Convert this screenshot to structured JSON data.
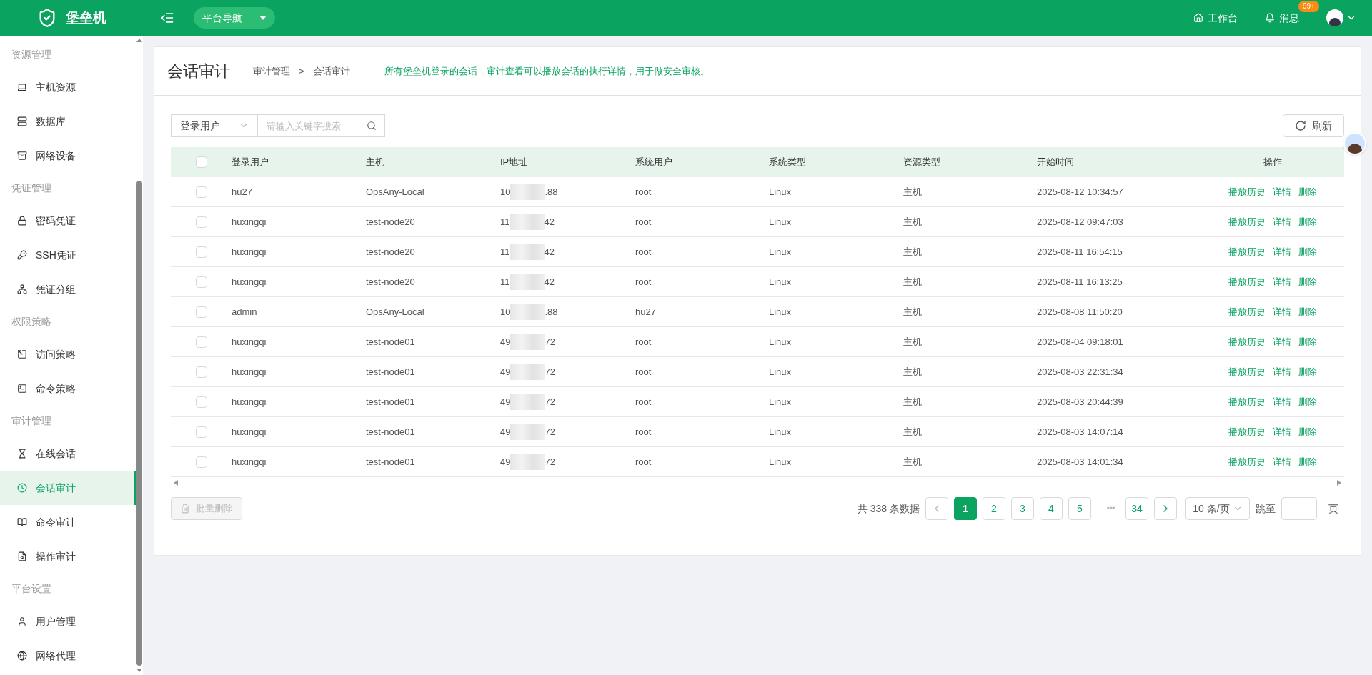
{
  "header": {
    "logo": "堡垒机",
    "nav_button": "平台导航",
    "links": [
      {
        "kind": "home",
        "label": "工作台"
      },
      {
        "kind": "bell",
        "label": "消息",
        "badge": "99+"
      }
    ]
  },
  "sidebar": {
    "groups": [
      {
        "title": "资源管理",
        "items": [
          {
            "label": "主机资源",
            "selected": false
          },
          {
            "label": "数据库",
            "selected": false
          },
          {
            "label": "网络设备",
            "selected": false
          }
        ]
      },
      {
        "title": "凭证管理",
        "items": [
          {
            "label": "密码凭证",
            "selected": false
          },
          {
            "label": "SSH凭证",
            "selected": false
          },
          {
            "label": "凭证分组",
            "selected": false
          }
        ]
      },
      {
        "title": "权限策略",
        "items": [
          {
            "label": "访问策略",
            "selected": false
          },
          {
            "label": "命令策略",
            "selected": false
          }
        ]
      },
      {
        "title": "审计管理",
        "items": [
          {
            "label": "在线会话",
            "selected": false
          },
          {
            "label": "会话审计",
            "selected": true
          },
          {
            "label": "命令审计",
            "selected": false
          },
          {
            "label": "操作审计",
            "selected": false
          }
        ]
      },
      {
        "title": "平台设置",
        "items": [
          {
            "label": "用户管理",
            "selected": false
          },
          {
            "label": "网络代理",
            "selected": false
          }
        ]
      }
    ]
  },
  "page": {
    "title": "会话审计",
    "breadcrumb": [
      "审计管理",
      "会话审计"
    ],
    "breadcrumb_separator": ">",
    "description": "所有堡垒机登录的会话，审计查看可以播放会话的执行详情，用于做安全审核。"
  },
  "toolbar": {
    "filter": "登录用户",
    "search_placeholder": "请输入关键字搜索",
    "refresh": "刷新"
  },
  "table": {
    "columns": [
      "登录用户",
      "主机",
      "IP地址",
      "系统用户",
      "系统类型",
      "资源类型",
      "开始时间",
      "操作"
    ],
    "select_all": false,
    "rows": [
      {
        "checked": false,
        "user": "hu27",
        "host": "OpsAny-Local",
        "ip_start": "10",
        "ip_end": ".88",
        "sys_user": "root",
        "os": "Linux",
        "res": "主机",
        "time": "2025-08-12 10:34:57",
        "actions": [
          "播放历史",
          "详情",
          "删除"
        ]
      },
      {
        "checked": false,
        "user": "huxingqi",
        "host": "test-node20",
        "ip_start": "11",
        "ip_end": "42",
        "sys_user": "root",
        "os": "Linux",
        "res": "主机",
        "time": "2025-08-12 09:47:03",
        "actions": [
          "播放历史",
          "详情",
          "删除"
        ]
      },
      {
        "checked": false,
        "user": "huxingqi",
        "host": "test-node20",
        "ip_start": "11",
        "ip_end": "42",
        "sys_user": "root",
        "os": "Linux",
        "res": "主机",
        "time": "2025-08-11 16:54:15",
        "actions": [
          "播放历史",
          "详情",
          "删除"
        ]
      },
      {
        "checked": false,
        "user": "huxingqi",
        "host": "test-node20",
        "ip_start": "11",
        "ip_end": "42",
        "sys_user": "root",
        "os": "Linux",
        "res": "主机",
        "time": "2025-08-11 16:13:25",
        "actions": [
          "播放历史",
          "详情",
          "删除"
        ]
      },
      {
        "checked": false,
        "user": "admin",
        "host": "OpsAny-Local",
        "ip_start": "10",
        "ip_end": ".88",
        "sys_user": "hu27",
        "os": "Linux",
        "res": "主机",
        "time": "2025-08-08 11:50:20",
        "actions": [
          "播放历史",
          "详情",
          "删除"
        ]
      },
      {
        "checked": false,
        "user": "huxingqi",
        "host": "test-node01",
        "ip_start": "49",
        "ip_end": "72",
        "sys_user": "root",
        "os": "Linux",
        "res": "主机",
        "time": "2025-08-04 09:18:01",
        "actions": [
          "播放历史",
          "详情",
          "删除"
        ]
      },
      {
        "checked": false,
        "user": "huxingqi",
        "host": "test-node01",
        "ip_start": "49",
        "ip_end": "72",
        "sys_user": "root",
        "os": "Linux",
        "res": "主机",
        "time": "2025-08-03 22:31:34",
        "actions": [
          "播放历史",
          "详情",
          "删除"
        ]
      },
      {
        "checked": false,
        "user": "huxingqi",
        "host": "test-node01",
        "ip_start": "49",
        "ip_end": "72",
        "sys_user": "root",
        "os": "Linux",
        "res": "主机",
        "time": "2025-08-03 20:44:39",
        "actions": [
          "播放历史",
          "详情",
          "删除"
        ]
      },
      {
        "checked": false,
        "user": "huxingqi",
        "host": "test-node01",
        "ip_start": "49",
        "ip_end": "72",
        "sys_user": "root",
        "os": "Linux",
        "res": "主机",
        "time": "2025-08-03 14:07:14",
        "actions": [
          "播放历史",
          "详情",
          "删除"
        ]
      },
      {
        "checked": false,
        "user": "huxingqi",
        "host": "test-node01",
        "ip_start": "49",
        "ip_end": "72",
        "sys_user": "root",
        "os": "Linux",
        "res": "主机",
        "time": "2025-08-03 14:01:34",
        "actions": [
          "播放历史",
          "详情",
          "删除"
        ]
      }
    ]
  },
  "footer": {
    "batch_delete": "批量删除",
    "batch_disabled": true,
    "total": "共 338 条数据",
    "pages": [
      {
        "label": "1",
        "selected": true
      },
      {
        "label": "2",
        "selected": false
      },
      {
        "label": "3",
        "selected": false
      },
      {
        "label": "4",
        "selected": false
      },
      {
        "label": "5",
        "selected": false
      },
      {
        "label": "•••",
        "kind": "ellipsis"
      },
      {
        "label": "34",
        "selected": false
      }
    ],
    "page_size": "10 条/页",
    "jump_label": "跳至",
    "page_unit": "页"
  }
}
